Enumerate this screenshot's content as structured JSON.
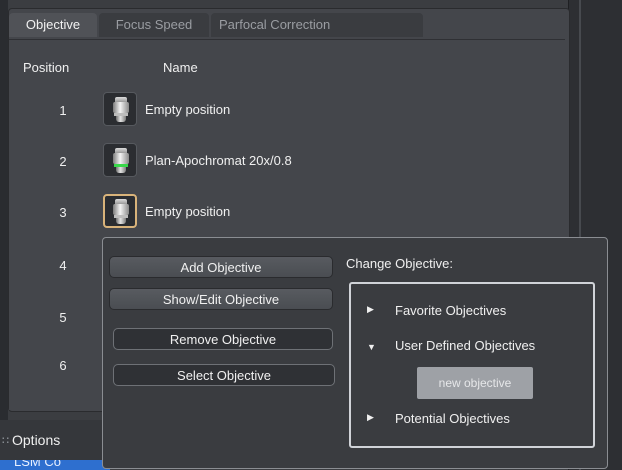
{
  "tabs": [
    {
      "label": "Objective",
      "active": true
    },
    {
      "label": "Focus Speed",
      "active": false
    },
    {
      "label": "Parfocal Correction",
      "active": false
    }
  ],
  "columns": {
    "position": "Position",
    "name": "Name"
  },
  "rows": [
    {
      "position": "1",
      "name": "Empty position",
      "icon": "objective-icon",
      "ring": "gray"
    },
    {
      "position": "2",
      "name": "Plan-Apochromat 20x/0.8",
      "icon": "objective-icon",
      "ring": "green"
    },
    {
      "position": "3",
      "name": "Empty position",
      "icon": "objective-icon",
      "ring": "gray",
      "selected": true
    },
    {
      "position": "4"
    },
    {
      "position": "5"
    },
    {
      "position": "6"
    }
  ],
  "popup": {
    "buttons": {
      "add": "Add Objective",
      "show_edit": "Show/Edit Objective",
      "remove": "Remove Objective",
      "select": "Select Objective"
    },
    "change_label": "Change Objective:",
    "tree": {
      "favorite": "Favorite Objectives",
      "user_defined": "User Defined Objectives",
      "new_objective": "new objective",
      "potential": "Potential Objectives"
    }
  },
  "options": {
    "label": "Options",
    "next": "LSM Co"
  },
  "colors": {
    "selected_border": "#d9b37a",
    "green_ring": "#38d84a",
    "accent_blue": "#2e6fcf"
  }
}
